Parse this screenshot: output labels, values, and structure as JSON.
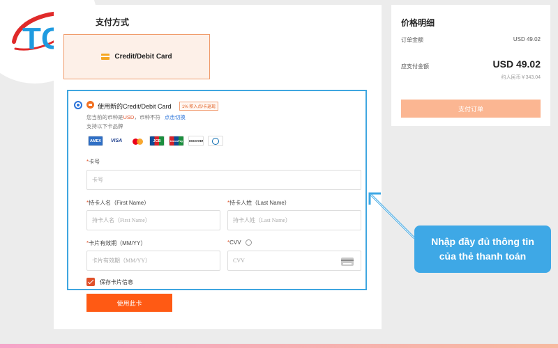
{
  "logo": {
    "text": "TG",
    "colors": {
      "letters": "#1f9be0",
      "swoosh": "#e02a2a"
    }
  },
  "payment": {
    "section_title": "支付方式",
    "method_label": "Credit/Debit Card",
    "new_card_label": "使用新的Credit/Debit Card",
    "promo_badge": "1% 积入点/卡返现",
    "currency_note_prefix": "您当前的币种是",
    "currency": "USD",
    "currency_note_suffix": "，币种不符",
    "switch_link": "点击切换",
    "brands_note": "支持以下卡品牌",
    "brands": [
      {
        "name": "amex",
        "label": "AMEX"
      },
      {
        "name": "visa",
        "label": "VISA"
      },
      {
        "name": "mastercard",
        "label": ""
      },
      {
        "name": "jcb",
        "label": "JCB"
      },
      {
        "name": "unionpay",
        "label": "UnionPay"
      },
      {
        "name": "discover",
        "label": "DISCOVER"
      },
      {
        "name": "diners",
        "label": ""
      }
    ],
    "card_number": {
      "label": "卡号",
      "placeholder": "卡号"
    },
    "first_name": {
      "label": "持卡人名（First Name）",
      "placeholder": "持卡人名（First Name）"
    },
    "last_name": {
      "label": "持卡人姓（Last Name）",
      "placeholder": "持卡人姓（Last Name）"
    },
    "expiry": {
      "label": "卡片有效期（MM/YY）",
      "placeholder": "卡片有效期（MM/YY）"
    },
    "cvv": {
      "label": "CVV",
      "placeholder": "CVV"
    },
    "save_card_label": "保存卡片信息",
    "save_card_checked": true,
    "use_card_button": "使用此卡"
  },
  "price": {
    "title": "价格明细",
    "order_amount_label": "订单金额",
    "order_amount_value": "USD 49.02",
    "payable_label": "应支付金额",
    "payable_value": "USD 49.02",
    "approx_note": "约人民币￥343.04",
    "pay_button": "支付订单"
  },
  "callout": {
    "line1": "Nhập đầy đủ thông tin",
    "line2": "của thẻ thanh toán"
  },
  "colors": {
    "accent": "#ff5a14",
    "highlight": "#3fa6e0",
    "callout": "#3ea8e6"
  }
}
